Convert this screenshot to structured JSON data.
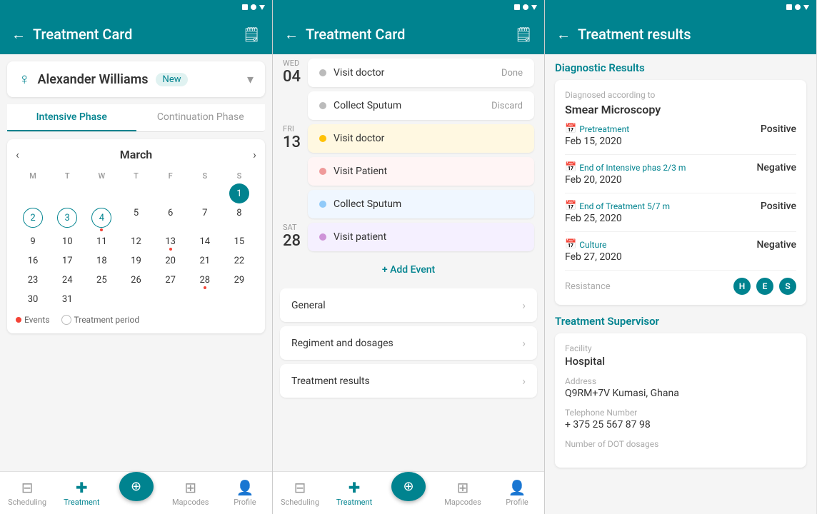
{
  "screen1": {
    "title": "Treatment Card",
    "patient": {
      "name": "Alexander Williams",
      "badge": "New"
    },
    "tabs": [
      "Intensive Phase",
      "Continuation Phase"
    ],
    "activeTab": 0,
    "calendar": {
      "month": "March",
      "dayHeaders": [
        "M",
        "T",
        "W",
        "T",
        "F",
        "S",
        "S"
      ],
      "weeks": [
        [
          null,
          null,
          null,
          null,
          null,
          null,
          1
        ],
        [
          2,
          3,
          4,
          5,
          6,
          7,
          8
        ],
        [
          9,
          10,
          11,
          12,
          13,
          14,
          15
        ],
        [
          16,
          17,
          18,
          19,
          20,
          21,
          22
        ],
        [
          23,
          24,
          25,
          26,
          27,
          28,
          29
        ],
        [
          30,
          31,
          null,
          null,
          null,
          null,
          null
        ]
      ],
      "today": 1,
      "circled": [
        2,
        3,
        4
      ],
      "dotDays": [
        4,
        13,
        28
      ]
    },
    "legend": {
      "events": "Events",
      "period": "Treatment period"
    },
    "nav": [
      {
        "label": "Scheduling",
        "icon": "📅"
      },
      {
        "label": "Treatment",
        "icon": "💊"
      },
      {
        "label": "",
        "icon": "🎯"
      },
      {
        "label": "Mapcodes",
        "icon": "🗺️"
      },
      {
        "label": "Profile",
        "icon": "👤"
      }
    ]
  },
  "screen2": {
    "title": "Treatment Card",
    "events": [
      {
        "date_day": "WED",
        "date_num": "04",
        "items": [
          {
            "name": "Visit doctor",
            "status": "Done",
            "dot": "gray"
          },
          {
            "name": "Collect Sputum",
            "status": "Discard",
            "dot": "gray"
          }
        ]
      },
      {
        "date_day": "FRI",
        "date_num": "13",
        "items": [
          {
            "name": "Visit doctor",
            "status": "",
            "dot": "yellow",
            "bg": "yellow"
          },
          {
            "name": "Visit Patient",
            "status": "",
            "dot": "red",
            "bg": "red"
          },
          {
            "name": "Collect Sputum",
            "status": "",
            "dot": "blue",
            "bg": "blue"
          }
        ]
      },
      {
        "date_day": "SAT",
        "date_num": "28",
        "items": [
          {
            "name": "Visit patient",
            "status": "",
            "dot": "purple",
            "bg": "purple"
          }
        ]
      }
    ],
    "add_event": "+ Add Event",
    "sections": [
      {
        "label": "General"
      },
      {
        "label": "Regiment and dosages"
      },
      {
        "label": "Treatment results"
      }
    ],
    "nav": [
      {
        "label": "Scheduling",
        "icon": "📅"
      },
      {
        "label": "Treatment",
        "icon": "💊"
      },
      {
        "label": "",
        "icon": "🎯"
      },
      {
        "label": "Mapcodes",
        "icon": "🗺️"
      },
      {
        "label": "Profile",
        "icon": "👤"
      }
    ]
  },
  "screen3": {
    "title": "Treatment results",
    "diagnostic": {
      "section_title": "Diagnostic Results",
      "diagnosed_label": "Diagnosed according to",
      "diagnosed_value": "Smear Microscopy",
      "rows": [
        {
          "type": "Pretreatment",
          "date": "Feb 15, 2020",
          "result": "Positive"
        },
        {
          "type": "End of Intensive phas 2/3 m",
          "date": "Feb 20, 2020",
          "result": "Negative"
        },
        {
          "type": "End of Treatment 5/7 m",
          "date": "Feb 25, 2020",
          "result": "Positive"
        },
        {
          "type": "Culture",
          "date": "Feb 27, 2020",
          "result": "Negative"
        }
      ],
      "resistance_label": "Resistance",
      "resistance_badges": [
        "H",
        "E",
        "S"
      ]
    },
    "supervisor": {
      "section_title": "Treatment Supervisor",
      "fields": [
        {
          "label": "Facility",
          "value": "Hospital"
        },
        {
          "label": "Address",
          "value": "Q9RM+7V Kumasi, Ghana"
        },
        {
          "label": "Telephone Number",
          "value": "+ 375 25 567 87 98"
        },
        {
          "label": "Number of DOT dosages",
          "value": ""
        }
      ]
    }
  }
}
